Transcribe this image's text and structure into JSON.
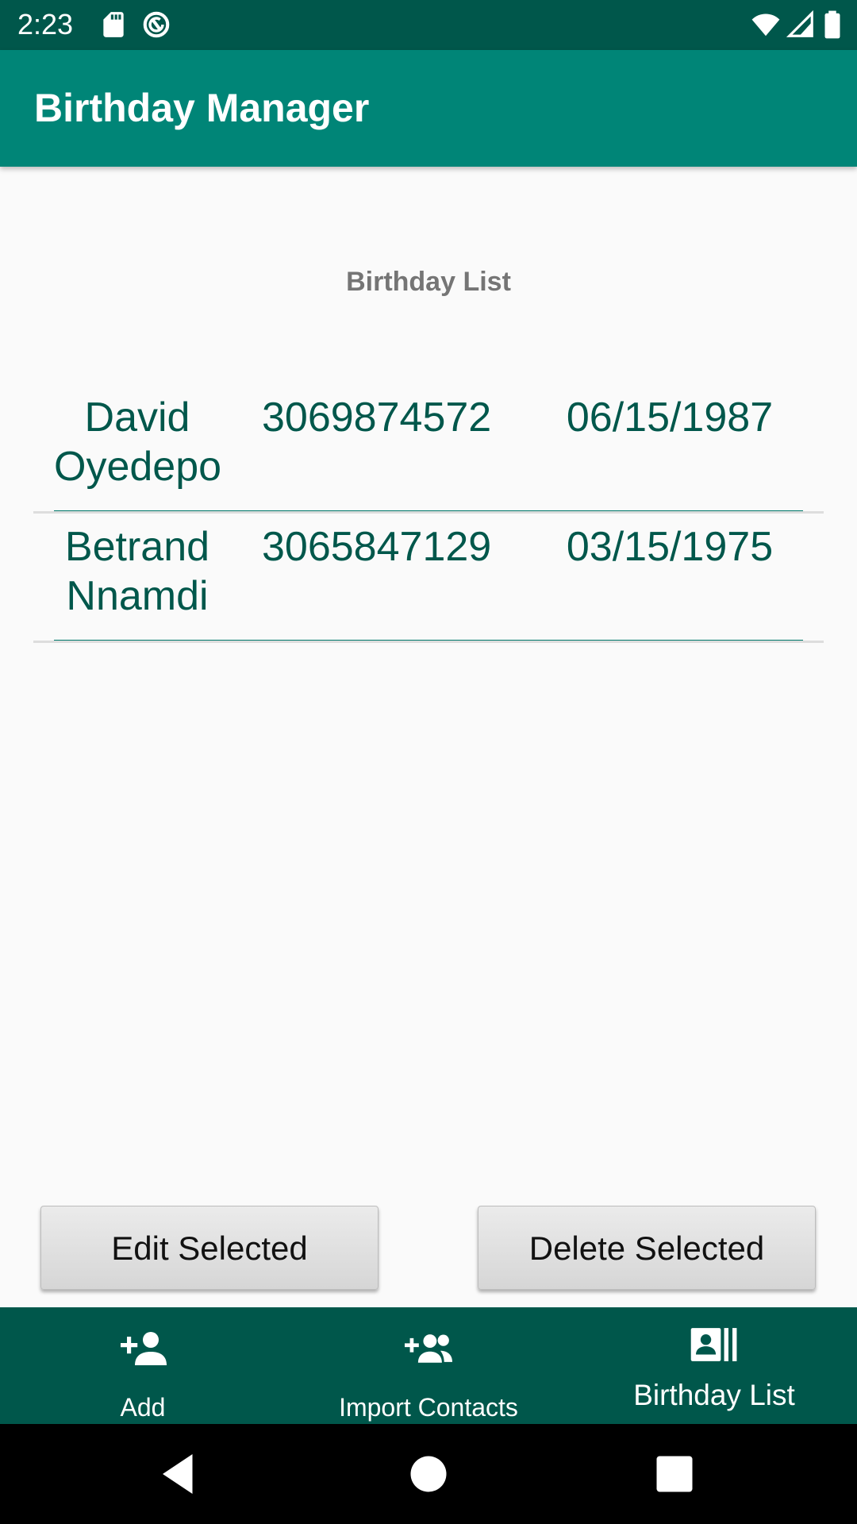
{
  "status_bar": {
    "time": "2:23",
    "icons": [
      "sd-card-icon",
      "sync-icon",
      "wifi-icon",
      "signal-icon",
      "battery-icon"
    ]
  },
  "app_bar": {
    "title": "Birthday Manager"
  },
  "main": {
    "section_title": "Birthday List",
    "rows": [
      {
        "name": "David Oyedepo",
        "phone": "3069874572",
        "date": "06/15/1987"
      },
      {
        "name": "Betrand Nnamdi",
        "phone": "3065847129",
        "date": "03/15/1975"
      }
    ]
  },
  "actions": {
    "edit_label": "Edit Selected",
    "delete_label": "Delete Selected"
  },
  "bottom_nav": {
    "items": [
      {
        "label": "Add",
        "icon": "add-person-icon"
      },
      {
        "label": "Import Contacts",
        "icon": "import-contacts-icon"
      },
      {
        "label": "Birthday List",
        "icon": "birthday-list-icon",
        "active": true
      }
    ]
  },
  "system_nav": {
    "icons": [
      "back-icon",
      "home-icon",
      "recents-icon"
    ]
  },
  "colors": {
    "status_bar": "#00574B",
    "app_bar": "#008577",
    "accent": "#00796B",
    "text_primary": "#00574B",
    "bottom_nav": "#00574B"
  }
}
